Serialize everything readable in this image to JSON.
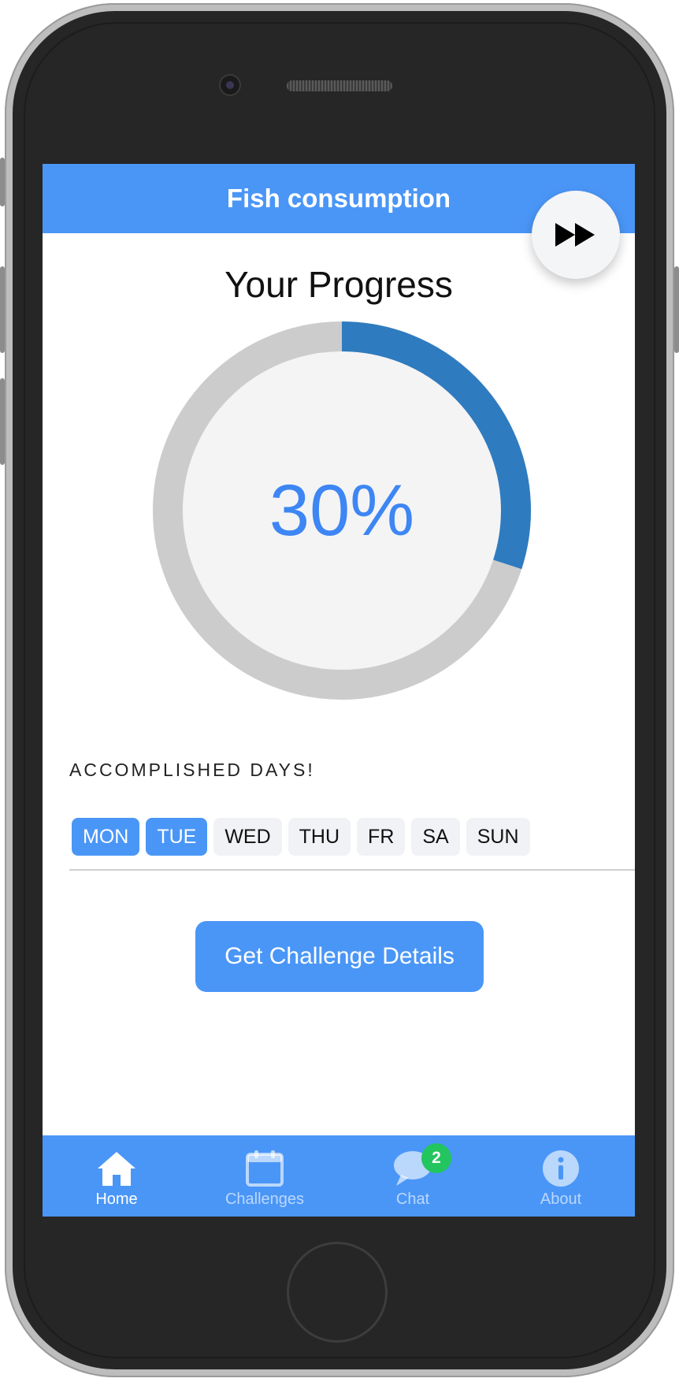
{
  "header": {
    "title": "Fish consumption",
    "skip_icon": "fast-forward-icon"
  },
  "progress": {
    "title": "Your Progress",
    "percent_label": "30%",
    "value": 0.3,
    "track_color": "#cccccc",
    "fill_color": "#2f7bbf"
  },
  "days": {
    "label": "ACCOMPLISHED DAYS!",
    "items": [
      {
        "label": "MON",
        "done": true
      },
      {
        "label": "TUE",
        "done": true
      },
      {
        "label": "WED",
        "done": false
      },
      {
        "label": "THU",
        "done": false
      },
      {
        "label": "FR",
        "done": false
      },
      {
        "label": "SA",
        "done": false
      },
      {
        "label": "SUN",
        "done": false
      }
    ]
  },
  "cta": {
    "label": "Get Challenge Details"
  },
  "tabs": [
    {
      "label": "Home",
      "icon": "home-icon",
      "active": true
    },
    {
      "label": "Challenges",
      "icon": "calendar-icon",
      "active": false
    },
    {
      "label": "Chat",
      "icon": "chat-bubble-icon",
      "active": false,
      "badge": "2"
    },
    {
      "label": "About",
      "icon": "info-icon",
      "active": false
    }
  ],
  "colors": {
    "accent": "#4a96f7",
    "badge": "#22c55e",
    "percent_text": "#3d86f4"
  }
}
